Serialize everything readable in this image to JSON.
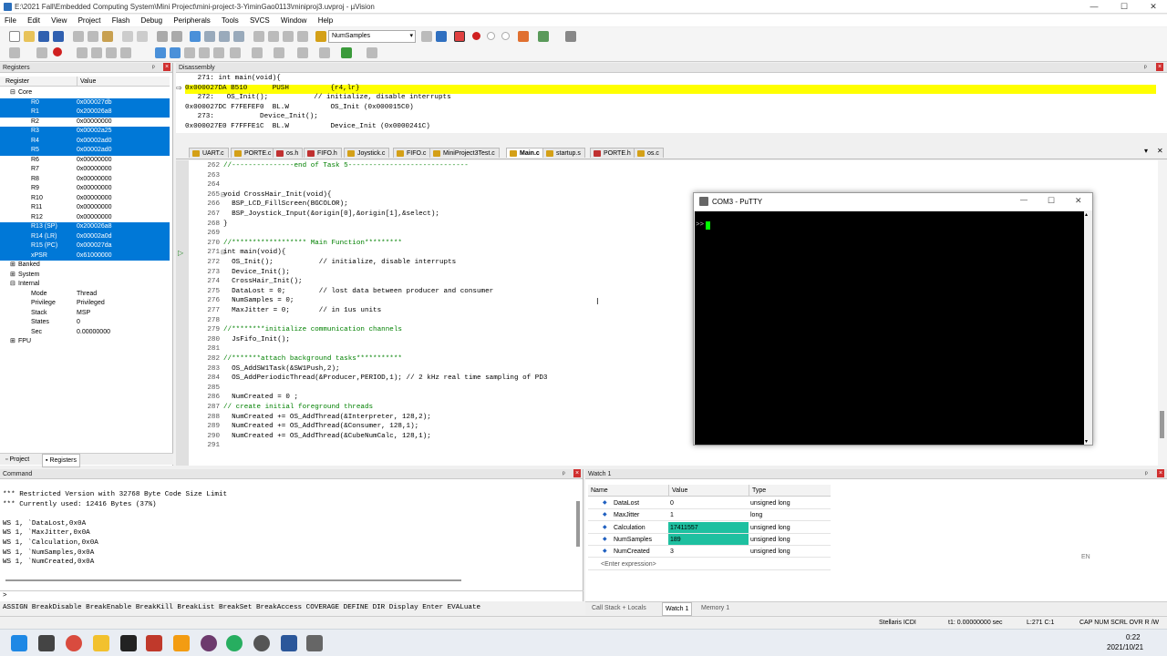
{
  "window": {
    "title": "E:\\2021 Fall\\Embedded Computing System\\Mini Project\\mini-project-3-YiminGao0113\\miniproj3.uvproj - µVision",
    "minimize": "—",
    "maximize": "☐",
    "close": "✕"
  },
  "menu": [
    "File",
    "Edit",
    "View",
    "Project",
    "Flash",
    "Debug",
    "Peripherals",
    "Tools",
    "SVCS",
    "Window",
    "Help"
  ],
  "toolbar": {
    "combo_value": "NumSamples"
  },
  "registers": {
    "title": "Registers",
    "col_register": "Register",
    "col_value": "Value",
    "group_core": "Core",
    "rows": [
      {
        "name": "R0",
        "value": "0x000027db",
        "sel": true
      },
      {
        "name": "R1",
        "value": "0x200026a8",
        "sel": true
      },
      {
        "name": "R2",
        "value": "0x00000000",
        "sel": false
      },
      {
        "name": "R3",
        "value": "0x00002a25",
        "sel": true
      },
      {
        "name": "R4",
        "value": "0x00002ad0",
        "sel": true
      },
      {
        "name": "R5",
        "value": "0x00002ad0",
        "sel": true
      },
      {
        "name": "R6",
        "value": "0x00000000",
        "sel": false
      },
      {
        "name": "R7",
        "value": "0x00000000",
        "sel": false
      },
      {
        "name": "R8",
        "value": "0x00000000",
        "sel": false
      },
      {
        "name": "R9",
        "value": "0x00000000",
        "sel": false
      },
      {
        "name": "R10",
        "value": "0x00000000",
        "sel": false
      },
      {
        "name": "R11",
        "value": "0x00000000",
        "sel": false
      },
      {
        "name": "R12",
        "value": "0x00000000",
        "sel": false
      },
      {
        "name": "R13 (SP)",
        "value": "0x200026a8",
        "sel": true
      },
      {
        "name": "R14 (LR)",
        "value": "0x00002a0d",
        "sel": true
      },
      {
        "name": "R15 (PC)",
        "value": "0x000027da",
        "sel": true
      },
      {
        "name": "xPSR",
        "value": "0x61000000",
        "sel": true
      }
    ],
    "group_banked": "Banked",
    "group_system": "System",
    "group_internal": "Internal",
    "internal": [
      {
        "name": "Mode",
        "value": "Thread"
      },
      {
        "name": "Privilege",
        "value": "Privileged"
      },
      {
        "name": "Stack",
        "value": "MSP"
      },
      {
        "name": "States",
        "value": "0"
      },
      {
        "name": "Sec",
        "value": "0.00000000"
      }
    ],
    "group_fpu": "FPU",
    "tab_project": "Project",
    "tab_registers": "Registers"
  },
  "disassembly": {
    "title": "Disassembly",
    "lines": [
      "   271: int main(void){",
      "0x000027DA B510      PUSH          {r4,lr}",
      "   272:   OS_Init();           // initialize, disable interrupts",
      "0x000027DC F7FEFEF0  BL.W          OS_Init (0x000015C0)",
      "   273:           Device_Init();",
      "0x000027E0 F7FFFE1C  BL.W          Device_Init (0x0000241C)"
    ]
  },
  "editor": {
    "tabs": [
      "UART.c",
      "PORTE.c",
      "os.h",
      "FIFO.h",
      "Joystick.c",
      "FIFO.c",
      "MiniProject3Test.c",
      "Main.c",
      "startup.s",
      "PORTE.h",
      "os.c"
    ],
    "active_tab": "Main.c",
    "lines": [
      {
        "n": "262",
        "t": "//---------------end of Task 5-----------------------------"
      },
      {
        "n": "263",
        "t": ""
      },
      {
        "n": "264",
        "t": ""
      },
      {
        "n": "265",
        "t": "void CrossHair_Init(void){"
      },
      {
        "n": "266",
        "t": "  BSP_LCD_FillScreen(BGCOLOR);"
      },
      {
        "n": "267",
        "t": "  BSP_Joystick_Input(&origin[0],&origin[1],&select);"
      },
      {
        "n": "268",
        "t": "}"
      },
      {
        "n": "269",
        "t": ""
      },
      {
        "n": "270",
        "t": "//****************** Main Function*********"
      },
      {
        "n": "271",
        "t": "int main(void){"
      },
      {
        "n": "272",
        "t": "  OS_Init();           // initialize, disable interrupts"
      },
      {
        "n": "273",
        "t": "  Device_Init();"
      },
      {
        "n": "274",
        "t": "  CrossHair_Init();"
      },
      {
        "n": "275",
        "t": "  DataLost = 0;        // lost data between producer and consumer"
      },
      {
        "n": "276",
        "t": "  NumSamples = 0;"
      },
      {
        "n": "277",
        "t": "  MaxJitter = 0;       // in 1us units"
      },
      {
        "n": "278",
        "t": ""
      },
      {
        "n": "279",
        "t": "//********initialize communication channels"
      },
      {
        "n": "280",
        "t": "  JsFifo_Init();"
      },
      {
        "n": "281",
        "t": ""
      },
      {
        "n": "282",
        "t": "//*******attach background tasks***********"
      },
      {
        "n": "283",
        "t": "  OS_AddSW1Task(&SW1Push,2);"
      },
      {
        "n": "284",
        "t": "  OS_AddPeriodicThread(&Producer,PERIOD,1); // 2 kHz real time sampling of PD3"
      },
      {
        "n": "285",
        "t": ""
      },
      {
        "n": "286",
        "t": "  NumCreated = 0 ;"
      },
      {
        "n": "287",
        "t": "// create initial foreground threads"
      },
      {
        "n": "288",
        "t": "  NumCreated += OS_AddThread(&Interpreter, 128,2);"
      },
      {
        "n": "289",
        "t": "  NumCreated += OS_AddThread(&Consumer, 128,1);"
      },
      {
        "n": "290",
        "t": "  NumCreated += OS_AddThread(&CubeNumCalc, 128,1);"
      },
      {
        "n": "291",
        "t": ""
      }
    ]
  },
  "putty": {
    "title": "COM3 - PuTTY",
    "prompt": ">>"
  },
  "command": {
    "title": "Command",
    "lines": [
      "*** Restricted Version with 32768 Byte Code Size Limit",
      "*** Currently used: 12416 Bytes (37%)",
      "",
      "WS 1, `DataLost,0x0A",
      "WS 1, `MaxJitter,0x0A",
      "WS 1, `Calculation,0x0A",
      "WS 1, `NumSamples,0x0A",
      "WS 1, `NumCreated,0x0A"
    ],
    "prompt": ">",
    "autocomplete": "ASSIGN BreakDisable BreakEnable BreakKill BreakList BreakSet BreakAccess COVERAGE DEFINE DIR Display Enter EVALuate"
  },
  "watch": {
    "title": "Watch 1",
    "col_name": "Name",
    "col_value": "Value",
    "col_type": "Type",
    "rows": [
      {
        "name": "DataLost",
        "value": "0",
        "type": "unsigned long",
        "hl": false
      },
      {
        "name": "MaxJitter",
        "value": "1",
        "type": "long",
        "hl": false
      },
      {
        "name": "Calculation",
        "value": "17411557",
        "type": "unsigned long",
        "hl": true
      },
      {
        "name": "NumSamples",
        "value": "189",
        "type": "unsigned long",
        "hl": true
      },
      {
        "name": "NumCreated",
        "value": "3",
        "type": "unsigned long",
        "hl": false
      }
    ],
    "enter_expression": "<Enter expression>",
    "tabs": [
      "Call Stack + Locals",
      "Watch 1",
      "Memory 1"
    ],
    "lang": "EN"
  },
  "status": {
    "debugger": "Stellaris ICDI",
    "time": "t1: 0.00000000 sec",
    "pos": "L:271 C:1",
    "flags": "CAP  NUM  SCRL  OVR  R /W"
  },
  "taskbar": {
    "time": "0:22",
    "date": "2021/10/21"
  },
  "colors": {
    "selection": "#0078d7",
    "exec_line": "#ffff00",
    "watch_highlight": "#1ec0a0",
    "putty_cursor": "#00ff00",
    "comment": "#008000"
  }
}
